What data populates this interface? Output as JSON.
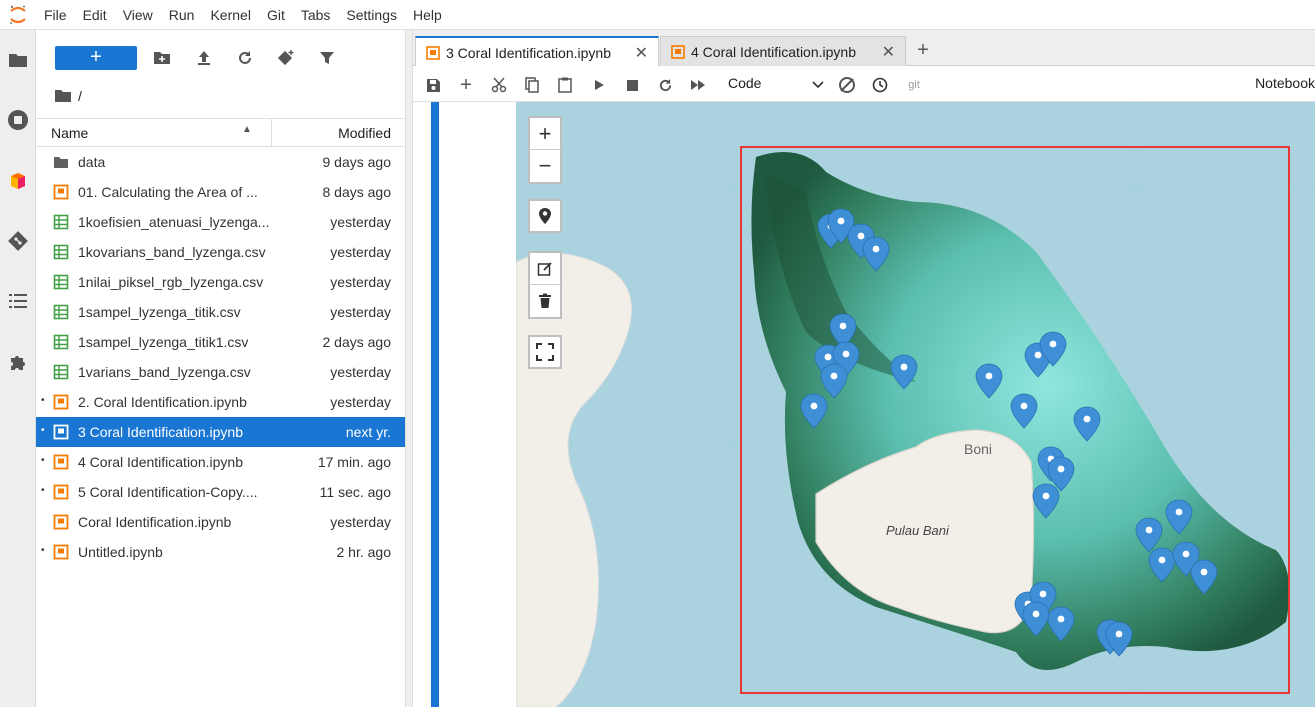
{
  "menubar": {
    "items": [
      "File",
      "Edit",
      "View",
      "Run",
      "Kernel",
      "Git",
      "Tabs",
      "Settings",
      "Help"
    ]
  },
  "filebrowser": {
    "new_label": "+",
    "breadcrumb": "/",
    "columns": {
      "name": "Name",
      "modified": "Modified"
    },
    "files": [
      {
        "name": "data",
        "modified": "9 days ago",
        "icon": "folder-icon",
        "running": false,
        "selected": false
      },
      {
        "name": "01. Calculating the Area of ...",
        "modified": "8 days ago",
        "icon": "notebook-icon",
        "running": false,
        "selected": false
      },
      {
        "name": "1koefisien_atenuasi_lyzenga...",
        "modified": "yesterday",
        "icon": "spreadsheet-icon",
        "running": false,
        "selected": false
      },
      {
        "name": "1kovarians_band_lyzenga.csv",
        "modified": "yesterday",
        "icon": "spreadsheet-icon",
        "running": false,
        "selected": false
      },
      {
        "name": "1nilai_piksel_rgb_lyzenga.csv",
        "modified": "yesterday",
        "icon": "spreadsheet-icon",
        "running": false,
        "selected": false
      },
      {
        "name": "1sampel_lyzenga_titik.csv",
        "modified": "yesterday",
        "icon": "spreadsheet-icon",
        "running": false,
        "selected": false
      },
      {
        "name": "1sampel_lyzenga_titik1.csv",
        "modified": "2 days ago",
        "icon": "spreadsheet-icon",
        "running": false,
        "selected": false
      },
      {
        "name": "1varians_band_lyzenga.csv",
        "modified": "yesterday",
        "icon": "spreadsheet-icon",
        "running": false,
        "selected": false
      },
      {
        "name": "2. Coral Identification.ipynb",
        "modified": "yesterday",
        "icon": "notebook-icon",
        "running": true,
        "selected": false
      },
      {
        "name": "3 Coral Identification.ipynb",
        "modified": "next yr.",
        "icon": "notebook-icon",
        "running": true,
        "selected": true
      },
      {
        "name": "4 Coral Identification.ipynb",
        "modified": "17 min. ago",
        "icon": "notebook-icon",
        "running": true,
        "selected": false
      },
      {
        "name": "5 Coral Identification-Copy....",
        "modified": "11 sec. ago",
        "icon": "notebook-icon",
        "running": true,
        "selected": false
      },
      {
        "name": "Coral Identification.ipynb",
        "modified": "yesterday",
        "icon": "notebook-icon",
        "running": false,
        "selected": false
      },
      {
        "name": "Untitled.ipynb",
        "modified": "2 hr. ago",
        "icon": "notebook-icon",
        "running": true,
        "selected": false
      }
    ]
  },
  "tabs": [
    {
      "label": "3 Coral Identification.ipynb",
      "active": true,
      "close": "✕"
    },
    {
      "label": "4 Coral Identification.ipynb",
      "active": false,
      "close": "✕"
    }
  ],
  "tab_add": "+",
  "notebook_toolbar": {
    "cell_type": "Code",
    "git_label": "git",
    "kernel_label": "Notebook"
  },
  "map": {
    "zoom_in": "+",
    "zoom_out": "−",
    "place_labels": [
      "Boni",
      "Pulau Bani"
    ],
    "colors": {
      "sea": "#aad3df",
      "land": "#f2efe9",
      "marker": "#3f8fd6",
      "selection": "#e53935"
    }
  }
}
